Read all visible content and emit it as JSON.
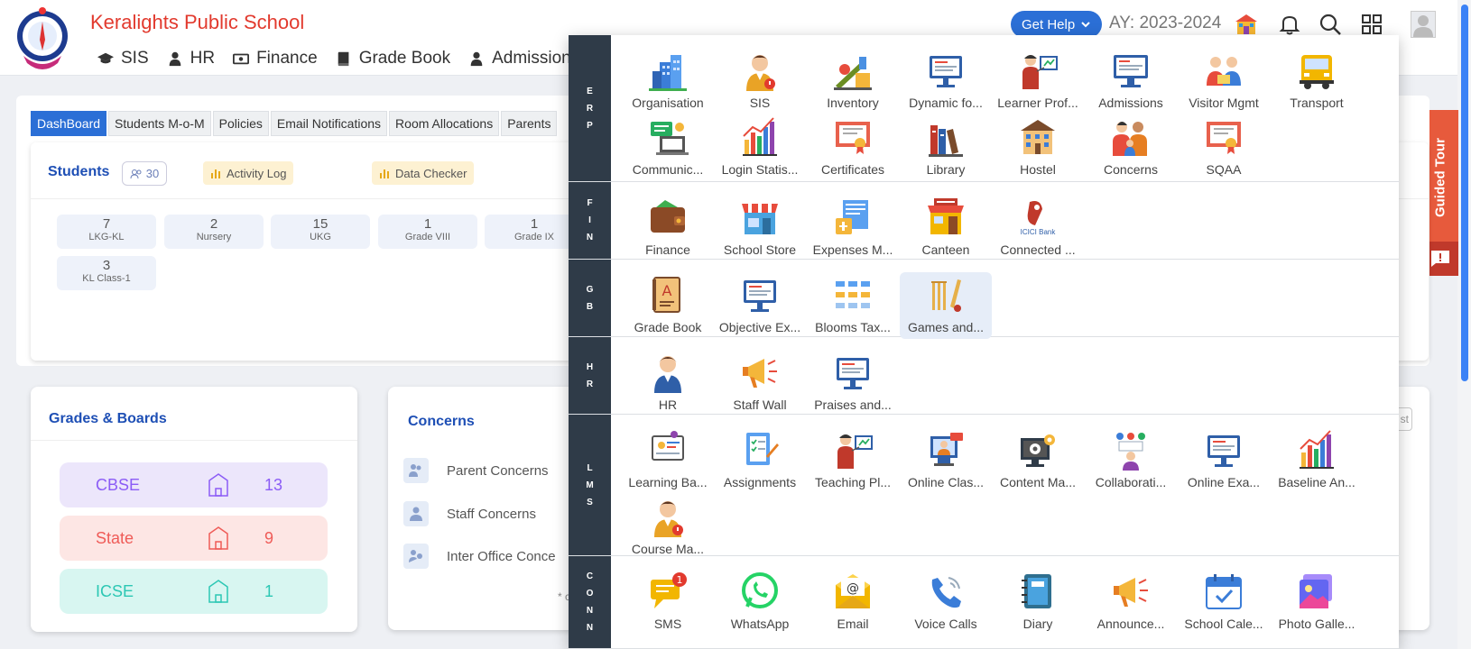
{
  "header": {
    "school_name": "Keralights Public School",
    "nav": [
      "SIS",
      "HR",
      "Finance",
      "Grade Book",
      "Admissions"
    ],
    "get_help": "Get Help",
    "academic_year": "AY: 2023-2024"
  },
  "tabs": [
    "DashBoard",
    "Students M-o-M",
    "Policies",
    "Email Notifications",
    "Room Allocations",
    "Parents"
  ],
  "students": {
    "title": "Students",
    "count": "30",
    "activity_log": "Activity Log",
    "data_checker": "Data Checker",
    "grades": [
      {
        "count": "7",
        "label": "LKG-KL"
      },
      {
        "count": "2",
        "label": "Nursery"
      },
      {
        "count": "15",
        "label": "UKG"
      },
      {
        "count": "1",
        "label": "Grade VIII"
      },
      {
        "count": "1",
        "label": "Grade IX"
      },
      {
        "count": "3",
        "label": "KL Class-1"
      }
    ]
  },
  "grades_boards": {
    "title": "Grades & Boards",
    "boards": [
      {
        "name": "CBSE",
        "count": "13",
        "color": "#8b5cf6",
        "bg": "#ece6fb"
      },
      {
        "name": "State",
        "count": "9",
        "color": "#ef5b57",
        "bg": "#fde6e4"
      },
      {
        "name": "ICSE",
        "count": "1",
        "color": "#2cc7b4",
        "bg": "#d8f6f1"
      }
    ]
  },
  "concerns": {
    "title": "Concerns",
    "items": [
      "Parent Concerns",
      "Staff Concerns",
      "Inter Office Conce"
    ],
    "footnote": "* c"
  },
  "side_text": {
    "link": "s",
    "button": "st"
  },
  "guided_tour": "Guided Tour",
  "apps_menu": {
    "sections": [
      {
        "label": "ERP",
        "apps": [
          {
            "name": "Organisation",
            "icon": "building-icon"
          },
          {
            "name": "SIS",
            "icon": "student-icon"
          },
          {
            "name": "Inventory",
            "icon": "inventory-icon"
          },
          {
            "name": "Dynamic fo...",
            "icon": "monitor-icon"
          },
          {
            "name": "Learner Prof...",
            "icon": "teacher-icon"
          },
          {
            "name": "Admissions",
            "icon": "admissions-icon"
          },
          {
            "name": "Visitor Mgmt",
            "icon": "visitor-icon"
          },
          {
            "name": "Transport",
            "icon": "bus-icon"
          },
          {
            "name": "Communic...",
            "icon": "chat-icon"
          },
          {
            "name": "Login Statis...",
            "icon": "bar-chart-icon"
          },
          {
            "name": "Certificates",
            "icon": "certificate-icon"
          },
          {
            "name": "Library",
            "icon": "books-icon"
          },
          {
            "name": "Hostel",
            "icon": "hostel-icon"
          },
          {
            "name": "Concerns",
            "icon": "family-icon"
          },
          {
            "name": "SQAA",
            "icon": "certificate-icon"
          }
        ]
      },
      {
        "label": "FIN",
        "apps": [
          {
            "name": "Finance",
            "icon": "wallet-icon"
          },
          {
            "name": "School Store",
            "icon": "store-icon"
          },
          {
            "name": "Expenses M...",
            "icon": "expenses-icon"
          },
          {
            "name": "Canteen",
            "icon": "canteen-icon"
          },
          {
            "name": "Connected ...",
            "icon": "bank-icon",
            "text": "ICICI Bank"
          }
        ]
      },
      {
        "label": "GB",
        "apps": [
          {
            "name": "Grade Book",
            "icon": "gradebook-icon"
          },
          {
            "name": "Objective Ex...",
            "icon": "monitor-icon"
          },
          {
            "name": "Blooms Tax...",
            "icon": "taxonomy-icon"
          },
          {
            "name": "Games and...",
            "icon": "cricket-icon"
          }
        ]
      },
      {
        "label": "HR",
        "apps": [
          {
            "name": "HR",
            "icon": "person-icon"
          },
          {
            "name": "Staff Wall",
            "icon": "megaphone-icon"
          },
          {
            "name": "Praises and...",
            "icon": "monitor-icon"
          }
        ]
      },
      {
        "label": "LMS",
        "apps": [
          {
            "name": "Learning Ba...",
            "icon": "learning-icon"
          },
          {
            "name": "Assignments",
            "icon": "assignment-icon"
          },
          {
            "name": "Teaching Pl...",
            "icon": "teacher-icon"
          },
          {
            "name": "Online Clas...",
            "icon": "online-class-icon"
          },
          {
            "name": "Content Ma...",
            "icon": "gear-monitor-icon"
          },
          {
            "name": "Collaborati...",
            "icon": "collab-icon"
          },
          {
            "name": "Online Exa...",
            "icon": "monitor-icon"
          },
          {
            "name": "Baseline An...",
            "icon": "bar-chart-icon"
          },
          {
            "name": "Course Ma...",
            "icon": "student-icon"
          }
        ]
      },
      {
        "label": "CONN",
        "apps": [
          {
            "name": "SMS",
            "icon": "sms-icon",
            "text": "1"
          },
          {
            "name": "WhatsApp",
            "icon": "whatsapp-icon"
          },
          {
            "name": "Email",
            "icon": "email-icon",
            "text": "@"
          },
          {
            "name": "Voice Calls",
            "icon": "phone-icon"
          },
          {
            "name": "Diary",
            "icon": "diary-icon"
          },
          {
            "name": "Announce...",
            "icon": "megaphone-icon"
          },
          {
            "name": "School Cale...",
            "icon": "calendar-icon"
          },
          {
            "name": "Photo Galle...",
            "icon": "photo-icon"
          }
        ]
      }
    ]
  }
}
